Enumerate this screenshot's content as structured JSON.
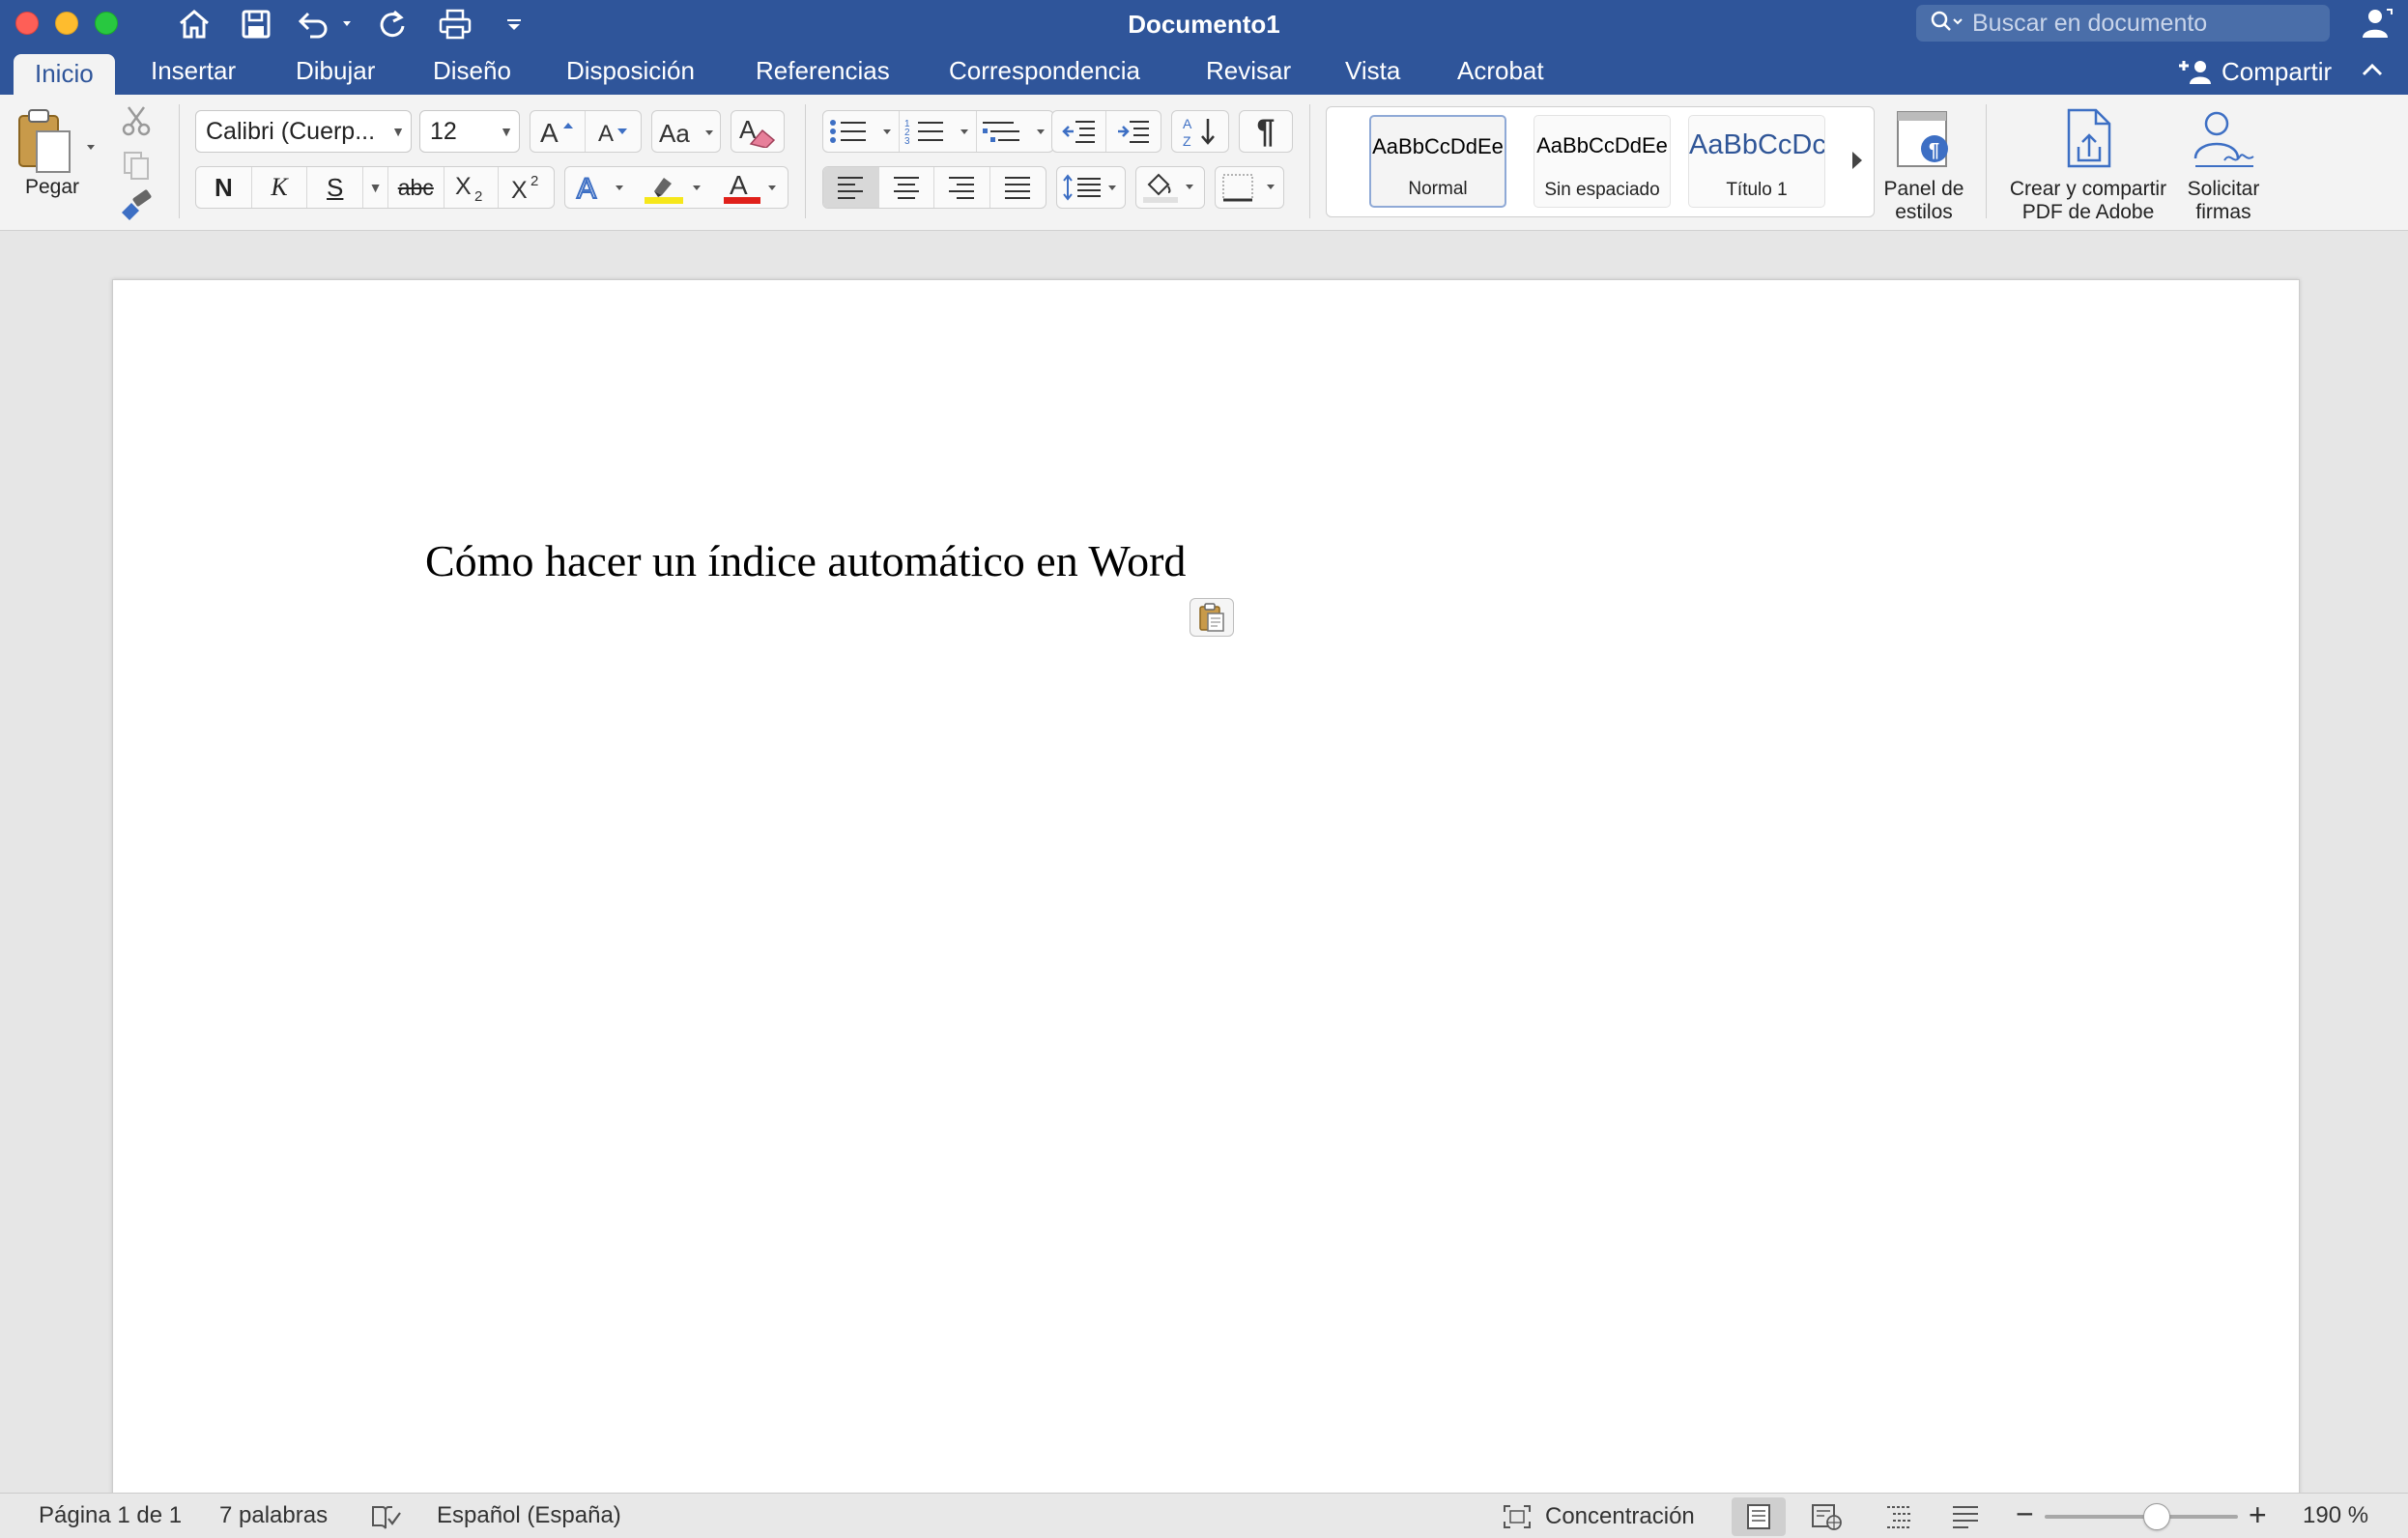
{
  "titlebar": {
    "document_title": "Documento1",
    "search_placeholder": "Buscar en documento"
  },
  "tabs": [
    {
      "label": "Inicio",
      "active": true
    },
    {
      "label": "Insertar"
    },
    {
      "label": "Dibujar"
    },
    {
      "label": "Diseño"
    },
    {
      "label": "Disposición"
    },
    {
      "label": "Referencias"
    },
    {
      "label": "Correspondencia"
    },
    {
      "label": "Revisar"
    },
    {
      "label": "Vista"
    },
    {
      "label": "Acrobat"
    }
  ],
  "share_label": "Compartir",
  "ribbon": {
    "paste_label": "Pegar",
    "font_name": "Calibri (Cuerp...",
    "font_size": "12",
    "bold": "N",
    "italic": "K",
    "underline": "S",
    "strikethrough": "abc",
    "styles": [
      {
        "sample": "AaBbCcDdEe",
        "name": "Normal"
      },
      {
        "sample": "AaBbCcDdEe",
        "name": "Sin espaciado"
      },
      {
        "sample": "AaBbCcDc",
        "name": "Título 1"
      }
    ],
    "styles_pane_label_1": "Panel de",
    "styles_pane_label_2": "estilos",
    "adobe_label_1": "Crear y compartir",
    "adobe_label_2": "PDF de Adobe",
    "sign_label_1": "Solicitar",
    "sign_label_2": "firmas"
  },
  "document": {
    "heading": "Cómo hacer un índice automático en Word"
  },
  "statusbar": {
    "page": "Página 1 de 1",
    "words": "7 palabras",
    "language": "Español (España)",
    "focus": "Concentración",
    "zoom": "190 %",
    "zoom_level_percent": 190
  },
  "colors": {
    "titlebar_bg": "#2f559a",
    "ribbon_bg": "#f3f3f3",
    "accent": "#2f559a",
    "font_color_red": "#e0201a",
    "highlight_yellow": "#f6e71b"
  }
}
